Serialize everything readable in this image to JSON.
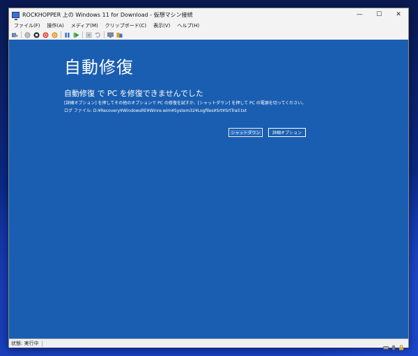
{
  "window": {
    "title": "ROCKHOPPER 上の Windows 11 for Download - 仮想マシン接続",
    "controls": {
      "minimize": "—",
      "maximize": "☐",
      "close": "✕"
    }
  },
  "menu": [
    {
      "label": "ファイル(F)"
    },
    {
      "label": "操作(A)"
    },
    {
      "label": "メディア(M)"
    },
    {
      "label": "クリップボード(C)"
    },
    {
      "label": "表示(V)"
    },
    {
      "label": "ヘルプ(H)"
    }
  ],
  "toolbar": {
    "icons": [
      "ctrl-alt-del-icon",
      "start-icon",
      "turn-off-icon",
      "shutdown-icon",
      "save-icon",
      "pause-icon",
      "reset-icon",
      "checkpoint-icon",
      "revert-icon",
      "enhanced-session-icon",
      "share-icon"
    ],
    "colors": {
      "stop": "#d0342c",
      "shutdown": "#e0392b",
      "save": "#e08a1e",
      "pause": "#2a62c9",
      "play": "#2e9b3a"
    }
  },
  "recovery": {
    "heading": "自動修復",
    "subheading": "自動修復 で PC を修復できませんでした",
    "description": "[詳細オプション] を押してその他のオプションで PC の修復を試すか、[シャットダウン] を押して PC の電源を切ってください。",
    "log_path": "ログ ファイル: D:¥Recovery¥WindowsRE¥Winre.wim¥System32¥Logfiles¥Srt¥SrtTrail.txt",
    "buttons": {
      "shutdown": "シャットダウン",
      "advanced": "詳細オプション"
    },
    "background_color": "#1a5eb1"
  },
  "status": {
    "text": "状態: 実行中"
  }
}
